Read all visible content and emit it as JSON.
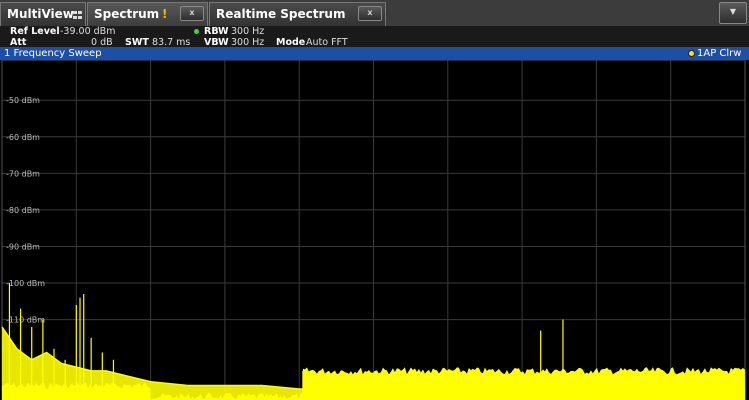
{
  "tabs": {
    "multiview_label": "MultiView",
    "spectrum_label": "Spectrum",
    "realtime_label": "Realtime Spectrum",
    "close_glyph": "x",
    "warning_glyph": "!",
    "dropdown_glyph": "▼"
  },
  "settings": {
    "ref_level_label": "Ref Level",
    "ref_level_value": "-39.00 dBm",
    "att_label": "Att",
    "att_value": "0 dB",
    "swt_label": "SWT",
    "swt_value": "83.7 ms",
    "rbw_label": "RBW",
    "rbw_value": "300 Hz",
    "vbw_label": "VBW",
    "vbw_value": "300 Hz",
    "mode_label": "Mode",
    "mode_value": "Auto FFT"
  },
  "diagram": {
    "title": "1 Frequency Sweep",
    "trace_label": "1AP Clrw",
    "trace_color": "#ffff00",
    "accent_color": "#1e4fa6"
  },
  "chart_data": {
    "type": "line",
    "ylabel": "",
    "xlabel": "",
    "y_tick_labels": [
      "-50 dBm",
      "-60 dBm",
      "-70 dBm",
      "-80 dBm",
      "-90 dBm",
      "-100 dBm",
      "-110 dBm"
    ],
    "y_ticks": [
      -50,
      -60,
      -70,
      -80,
      -90,
      -100,
      -110
    ],
    "ylim": [
      -39,
      -132
    ],
    "x_divisions": 10,
    "grid": true,
    "series": [
      {
        "x": [
          0,
          0.2,
          0.4,
          0.6,
          0.8,
          1.0,
          1.2,
          1.4,
          1.6,
          1.8,
          2.0,
          2.5,
          3.0,
          3.5,
          4.0,
          4.5,
          5.0,
          5.5,
          6.0,
          6.5,
          7.0,
          7.2,
          7.3,
          7.5,
          7.7,
          8.0,
          8.5,
          9.0,
          9.5,
          10.0
        ],
        "y": [
          -112,
          -118,
          -121,
          -119,
          -122,
          -123,
          -124,
          -124,
          -125,
          -126,
          -127,
          -128,
          -128,
          -128,
          -129,
          -129,
          -129,
          -129,
          -129,
          -129,
          -129,
          -129,
          -129,
          -129,
          -129,
          -129,
          -129,
          -129,
          -129,
          -129
        ]
      },
      {
        "x": [
          0.1,
          0.25,
          0.4,
          0.55,
          0.7,
          0.85,
          1.0,
          1.05,
          1.1,
          1.2,
          1.35,
          1.5
        ],
        "y": [
          -100,
          -107,
          -112,
          -110,
          -118,
          -121,
          -106,
          -104,
          -103,
          -115,
          -119,
          -121
        ]
      },
      {
        "x": [
          7.25,
          7.55
        ],
        "y": [
          -113,
          -110
        ]
      },
      {
        "x": [
          4.05,
          4.05
        ],
        "y": [
          -129,
          -124
        ]
      }
    ],
    "noise_floor": [
      {
        "x_start": 0,
        "x_end": 2.0,
        "y": -128
      },
      {
        "x_start": 2.0,
        "x_end": 4.05,
        "y": -131
      },
      {
        "x_start": 4.05,
        "x_end": 10.0,
        "y": -124
      }
    ]
  }
}
